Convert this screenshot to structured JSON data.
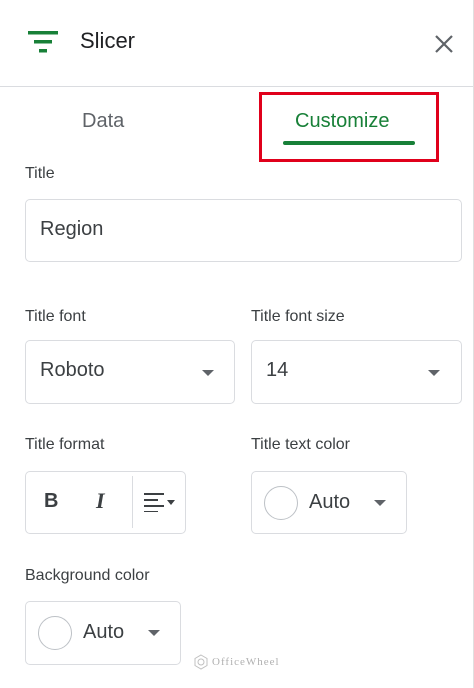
{
  "header": {
    "title": "Slicer"
  },
  "tabs": [
    {
      "label": "Data",
      "active": false
    },
    {
      "label": "Customize",
      "active": true
    }
  ],
  "title_section": {
    "label": "Title",
    "value": "Region"
  },
  "title_font": {
    "label": "Title font",
    "value": "Roboto"
  },
  "title_font_size": {
    "label": "Title font size",
    "value": "14"
  },
  "title_format": {
    "label": "Title format",
    "bold": "B",
    "italic": "I"
  },
  "title_text_color": {
    "label": "Title text color",
    "value": "Auto"
  },
  "background_color": {
    "label": "Background color",
    "value": "Auto"
  },
  "watermark": {
    "text": "OfficeWheel"
  },
  "colors": {
    "accent": "#188038",
    "highlight": "#e0001b",
    "text": "#3c4043",
    "muted": "#5f6368"
  },
  "icons": {
    "filter": "filter-icon",
    "close": "close-icon",
    "align": "align-left-icon"
  }
}
